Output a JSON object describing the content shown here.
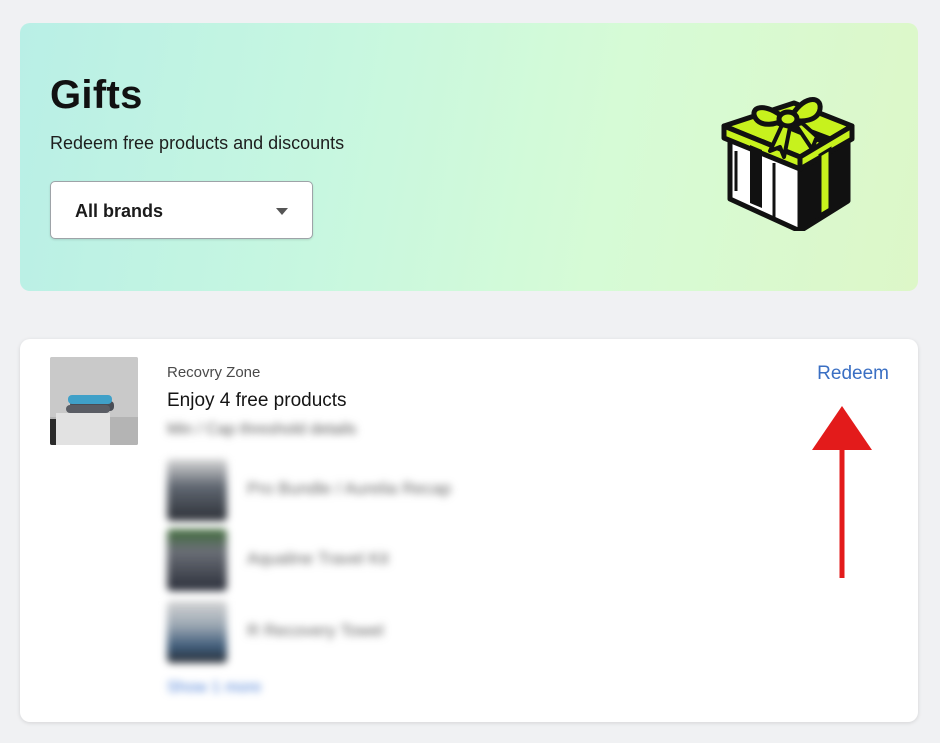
{
  "header": {
    "title": "Gifts",
    "subtitle": "Redeem free products and discounts",
    "brand_filter": {
      "selected": "All brands",
      "icon": "caret-down-icon"
    },
    "illustration": "gift-box-icon"
  },
  "offer": {
    "brand": "Recovry Zone",
    "title": "Enjoy 4 free products",
    "action_label": "Redeem",
    "fine_print": "Min / Cap threshold details",
    "products": [
      {
        "name": "Pro Bundle / Aurelia Recap"
      },
      {
        "name": "Aqualine Travel Kit"
      },
      {
        "name": "R Recovery Towel"
      }
    ],
    "more_link": "Show 1 more"
  },
  "colors": {
    "link": "#3a6fc3",
    "annotation_arrow": "#e31b1b",
    "gift_ribbon": "#c7f21d"
  }
}
